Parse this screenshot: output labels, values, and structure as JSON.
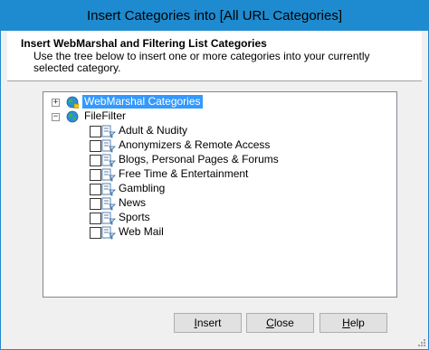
{
  "window": {
    "title": "Insert Categories into [All URL Categories]"
  },
  "header": {
    "title": "Insert WebMarshal and Filtering List Categories",
    "description": "Use the tree below to insert one or more categories into your currently selected category."
  },
  "tree": {
    "root": {
      "label": "WebMarshal Categories",
      "expanded": false,
      "selected": true
    },
    "filefilter": {
      "label": "FileFilter",
      "expanded": true
    },
    "categories": [
      {
        "label": "Adult & Nudity",
        "checked": false
      },
      {
        "label": "Anonymizers & Remote Access",
        "checked": false
      },
      {
        "label": "Blogs, Personal Pages & Forums",
        "checked": false
      },
      {
        "label": "Free Time & Entertainment",
        "checked": false
      },
      {
        "label": "Gambling",
        "checked": false
      },
      {
        "label": "News",
        "checked": false
      },
      {
        "label": "Sports",
        "checked": false
      },
      {
        "label": "Web Mail",
        "checked": false
      }
    ]
  },
  "buttons": {
    "insert_mnemonic": "I",
    "insert_rest": "nsert",
    "close_mnemonic": "C",
    "close_rest": "lose",
    "help_mnemonic": "H",
    "help_rest": "elp"
  },
  "colors": {
    "titlebar": "#1e8bd0",
    "selection": "#3399ff",
    "dialog_bg": "#f0f0f0"
  }
}
